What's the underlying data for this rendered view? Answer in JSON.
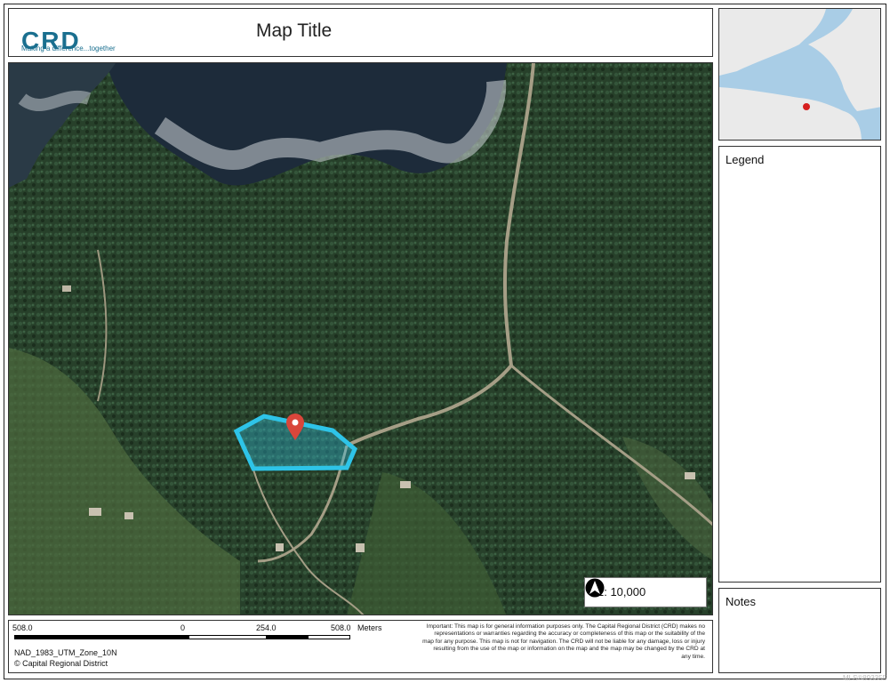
{
  "header": {
    "logo_text": "CRD",
    "tagline": "Making a difference...together",
    "map_title": "Map Title"
  },
  "map": {
    "scale_label": "1: 10,000",
    "north_arrow": "north-arrow-icon",
    "highlight_color": "#2ec4e8",
    "marker_color": "#d9463b"
  },
  "scale_bar": {
    "ticks": [
      "508.0",
      "0",
      "254.0",
      "508.0"
    ],
    "units": "Meters"
  },
  "footer": {
    "projection": "NAD_1983_UTM_Zone_10N",
    "credit": "© Capital Regional District",
    "disclaimer": "Important: This map is for general information purposes only. The Capital Regional District (CRD) makes no representations or warranties regarding the accuracy or completeness of this map or the suitability of the map for any purpose. This map is not for navigation. The CRD will not be liable for any damage, loss or injury resulting from the use of the map or information on the map and the map may be changed by the CRD at any time."
  },
  "panels": {
    "legend_title": "Legend",
    "notes_title": "Notes"
  },
  "watermark": "MLS®893355"
}
